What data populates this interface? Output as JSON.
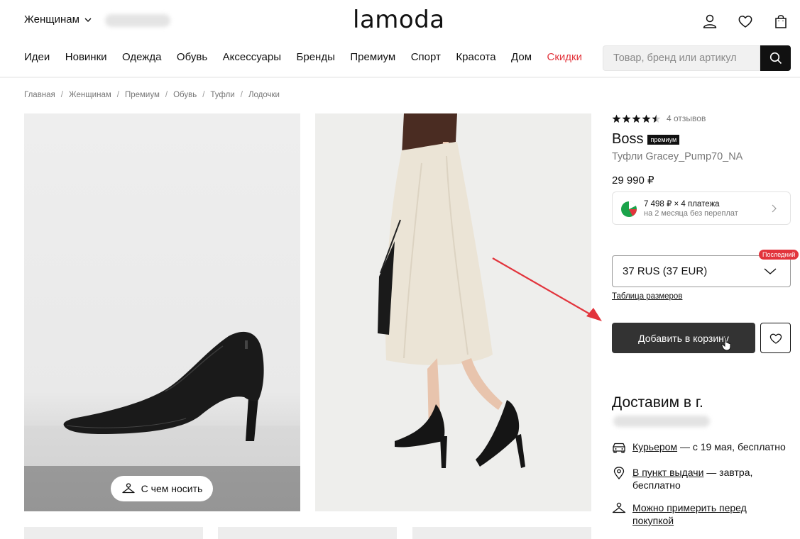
{
  "header": {
    "gender": "Женщинам",
    "logo": "lamoda",
    "icons": [
      "user-icon",
      "heart-icon",
      "bag-icon"
    ]
  },
  "nav": {
    "items": [
      "Идеи",
      "Новинки",
      "Одежда",
      "Обувь",
      "Аксессуары",
      "Бренды",
      "Премиум",
      "Спорт",
      "Красота",
      "Дом",
      "Скидки"
    ]
  },
  "search": {
    "placeholder": "Товар, бренд или артикул"
  },
  "breadcrumbs": [
    "Главная",
    "Женщинам",
    "Премиум",
    "Обувь",
    "Туфли",
    "Лодочки"
  ],
  "gallery": {
    "wear_button": "С чем носить"
  },
  "product": {
    "rating": 4.5,
    "reviews": "4 отзывов",
    "brand": "Boss",
    "premium_badge": "премиум",
    "name": "Туфли Gracey_Pump70_NA",
    "price": "29 990 ₽",
    "installment_line1": "7 498 ₽ × 4 платежа",
    "installment_line2": "на 2 месяца без переплат",
    "size_selected": "37 RUS (37 EUR)",
    "last_badge": "Последний",
    "size_table": "Таблица размеров",
    "add_to_cart": "Добавить в корзину"
  },
  "delivery": {
    "title": "Доставим в  г.",
    "courier_link": "Курьером",
    "courier_rest": " — с 19 мая, бесплатно",
    "pickup_link": "В пункт выдачи",
    "pickup_rest": " — завтра,",
    "pickup_rest2": "бесплатно",
    "fitting_line1": "Можно примерить перед",
    "fitting_line2": "покупкой"
  },
  "colors": {
    "sale": "#e2343c",
    "cart_button": "#333333",
    "annotation_arrow": "#e2343c"
  }
}
